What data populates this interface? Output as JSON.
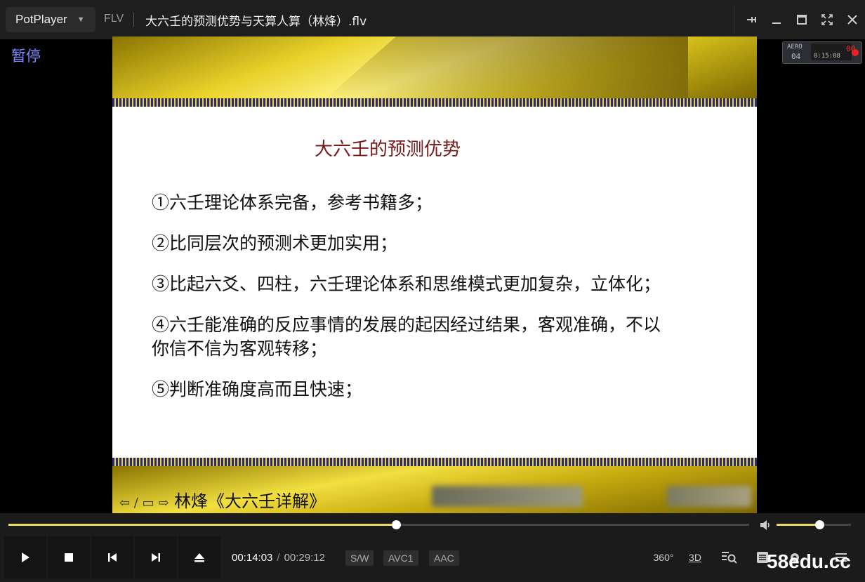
{
  "titlebar": {
    "app_name": "PotPlayer",
    "format": "FLV",
    "file_title": "大六壬的预测优势与天算人算（林烽）.flv"
  },
  "video": {
    "status": "暂停",
    "recorder": {
      "label": "AERO",
      "count": "04",
      "counter": "00",
      "time": "0:15:08"
    }
  },
  "slide": {
    "title": "大六壬的预测优势",
    "items": [
      "①六壬理论体系完备，参考书籍多；",
      "②比同层次的预测术更加实用；",
      "③比起六爻、四柱，六壬理论体系和思维模式更加复杂，立体化；",
      "④六壬能准确的反应事情的发展的起因经过结果，客观准确，不以你信不信为客观转移；",
      "⑤判断准确度高而且快速；"
    ],
    "footer_nav": "⇦ ∕ ▭ ⇨",
    "footer_title": "林烽《大六壬详解》"
  },
  "playback": {
    "current_time": "00:14:03",
    "total_time": "00:29:12",
    "progress_fraction": 0.523,
    "volume_fraction": 0.58
  },
  "badges": {
    "decoder": "S/W",
    "video_codec": "AVC1",
    "audio_codec": "AAC"
  },
  "toolbar_icons": {
    "vr": "360°",
    "stereo": "3D"
  },
  "watermark": "58edu.cc",
  "colors": {
    "accent": "#e8dc60",
    "pause_text": "#7a8cff",
    "background": "#000000"
  }
}
